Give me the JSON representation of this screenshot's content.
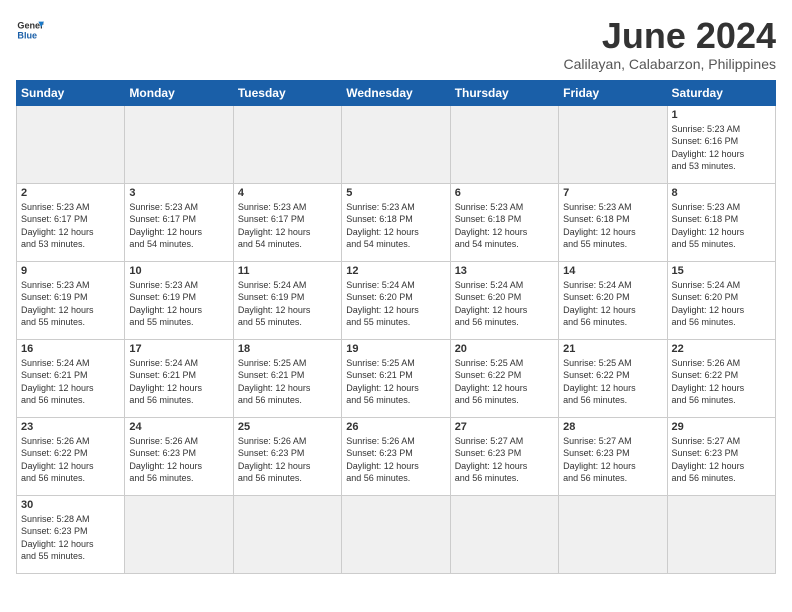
{
  "header": {
    "logo_text_general": "General",
    "logo_text_blue": "Blue",
    "title": "June 2024",
    "subtitle": "Calilayan, Calabarzon, Philippines"
  },
  "weekdays": [
    "Sunday",
    "Monday",
    "Tuesday",
    "Wednesday",
    "Thursday",
    "Friday",
    "Saturday"
  ],
  "weeks": [
    [
      {
        "day": "",
        "info": ""
      },
      {
        "day": "",
        "info": ""
      },
      {
        "day": "",
        "info": ""
      },
      {
        "day": "",
        "info": ""
      },
      {
        "day": "",
        "info": ""
      },
      {
        "day": "",
        "info": ""
      },
      {
        "day": "1",
        "info": "Sunrise: 5:23 AM\nSunset: 6:16 PM\nDaylight: 12 hours\nand 53 minutes."
      }
    ],
    [
      {
        "day": "2",
        "info": "Sunrise: 5:23 AM\nSunset: 6:17 PM\nDaylight: 12 hours\nand 53 minutes."
      },
      {
        "day": "3",
        "info": "Sunrise: 5:23 AM\nSunset: 6:17 PM\nDaylight: 12 hours\nand 54 minutes."
      },
      {
        "day": "4",
        "info": "Sunrise: 5:23 AM\nSunset: 6:17 PM\nDaylight: 12 hours\nand 54 minutes."
      },
      {
        "day": "5",
        "info": "Sunrise: 5:23 AM\nSunset: 6:18 PM\nDaylight: 12 hours\nand 54 minutes."
      },
      {
        "day": "6",
        "info": "Sunrise: 5:23 AM\nSunset: 6:18 PM\nDaylight: 12 hours\nand 54 minutes."
      },
      {
        "day": "7",
        "info": "Sunrise: 5:23 AM\nSunset: 6:18 PM\nDaylight: 12 hours\nand 55 minutes."
      },
      {
        "day": "8",
        "info": "Sunrise: 5:23 AM\nSunset: 6:18 PM\nDaylight: 12 hours\nand 55 minutes."
      }
    ],
    [
      {
        "day": "9",
        "info": "Sunrise: 5:23 AM\nSunset: 6:19 PM\nDaylight: 12 hours\nand 55 minutes."
      },
      {
        "day": "10",
        "info": "Sunrise: 5:23 AM\nSunset: 6:19 PM\nDaylight: 12 hours\nand 55 minutes."
      },
      {
        "day": "11",
        "info": "Sunrise: 5:24 AM\nSunset: 6:19 PM\nDaylight: 12 hours\nand 55 minutes."
      },
      {
        "day": "12",
        "info": "Sunrise: 5:24 AM\nSunset: 6:20 PM\nDaylight: 12 hours\nand 55 minutes."
      },
      {
        "day": "13",
        "info": "Sunrise: 5:24 AM\nSunset: 6:20 PM\nDaylight: 12 hours\nand 56 minutes."
      },
      {
        "day": "14",
        "info": "Sunrise: 5:24 AM\nSunset: 6:20 PM\nDaylight: 12 hours\nand 56 minutes."
      },
      {
        "day": "15",
        "info": "Sunrise: 5:24 AM\nSunset: 6:20 PM\nDaylight: 12 hours\nand 56 minutes."
      }
    ],
    [
      {
        "day": "16",
        "info": "Sunrise: 5:24 AM\nSunset: 6:21 PM\nDaylight: 12 hours\nand 56 minutes."
      },
      {
        "day": "17",
        "info": "Sunrise: 5:24 AM\nSunset: 6:21 PM\nDaylight: 12 hours\nand 56 minutes."
      },
      {
        "day": "18",
        "info": "Sunrise: 5:25 AM\nSunset: 6:21 PM\nDaylight: 12 hours\nand 56 minutes."
      },
      {
        "day": "19",
        "info": "Sunrise: 5:25 AM\nSunset: 6:21 PM\nDaylight: 12 hours\nand 56 minutes."
      },
      {
        "day": "20",
        "info": "Sunrise: 5:25 AM\nSunset: 6:22 PM\nDaylight: 12 hours\nand 56 minutes."
      },
      {
        "day": "21",
        "info": "Sunrise: 5:25 AM\nSunset: 6:22 PM\nDaylight: 12 hours\nand 56 minutes."
      },
      {
        "day": "22",
        "info": "Sunrise: 5:26 AM\nSunset: 6:22 PM\nDaylight: 12 hours\nand 56 minutes."
      }
    ],
    [
      {
        "day": "23",
        "info": "Sunrise: 5:26 AM\nSunset: 6:22 PM\nDaylight: 12 hours\nand 56 minutes."
      },
      {
        "day": "24",
        "info": "Sunrise: 5:26 AM\nSunset: 6:23 PM\nDaylight: 12 hours\nand 56 minutes."
      },
      {
        "day": "25",
        "info": "Sunrise: 5:26 AM\nSunset: 6:23 PM\nDaylight: 12 hours\nand 56 minutes."
      },
      {
        "day": "26",
        "info": "Sunrise: 5:26 AM\nSunset: 6:23 PM\nDaylight: 12 hours\nand 56 minutes."
      },
      {
        "day": "27",
        "info": "Sunrise: 5:27 AM\nSunset: 6:23 PM\nDaylight: 12 hours\nand 56 minutes."
      },
      {
        "day": "28",
        "info": "Sunrise: 5:27 AM\nSunset: 6:23 PM\nDaylight: 12 hours\nand 56 minutes."
      },
      {
        "day": "29",
        "info": "Sunrise: 5:27 AM\nSunset: 6:23 PM\nDaylight: 12 hours\nand 56 minutes."
      }
    ],
    [
      {
        "day": "30",
        "info": "Sunrise: 5:28 AM\nSunset: 6:23 PM\nDaylight: 12 hours\nand 55 minutes."
      },
      {
        "day": "",
        "info": ""
      },
      {
        "day": "",
        "info": ""
      },
      {
        "day": "",
        "info": ""
      },
      {
        "day": "",
        "info": ""
      },
      {
        "day": "",
        "info": ""
      },
      {
        "day": "",
        "info": ""
      }
    ]
  ]
}
